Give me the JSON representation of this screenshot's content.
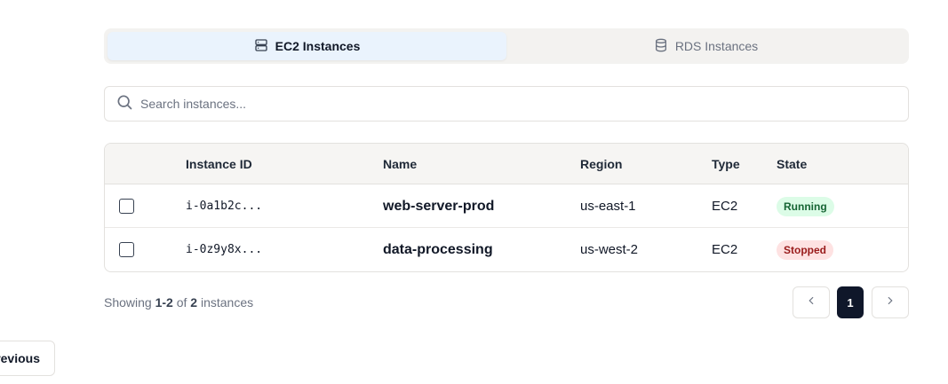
{
  "tabs": [
    {
      "label": "EC2 Instances",
      "icon": "server-icon",
      "active": true
    },
    {
      "label": "RDS Instances",
      "icon": "database-icon",
      "active": false
    }
  ],
  "search": {
    "placeholder": "Search instances...",
    "value": "",
    "icon": "search-icon"
  },
  "table": {
    "columns": [
      "Instance ID",
      "Name",
      "Region",
      "Type",
      "State"
    ],
    "rows": [
      {
        "instance_id": "i-0a1b2c...",
        "name": "web-server-prod",
        "region": "us-east-1",
        "type": "EC2",
        "state": "Running"
      },
      {
        "instance_id": "i-0z9y8x...",
        "name": "data-processing",
        "region": "us-west-2",
        "type": "EC2",
        "state": "Stopped"
      }
    ]
  },
  "footer": {
    "showing_prefix": "Showing",
    "range": "1-2",
    "of_text": "of",
    "total": "2",
    "suffix": "instances"
  },
  "pagination": {
    "current_page": "1",
    "prev_icon": "chevron-left-icon",
    "next_icon": "chevron-right-icon"
  },
  "outer_prev_label": "revious",
  "colors": {
    "running_bg": "#dcfce7",
    "running_fg": "#166534",
    "stopped_bg": "#fee2e2",
    "stopped_fg": "#991b1b",
    "page_active": "#0f172a",
    "tab_active_bg": "#eaf3fd"
  }
}
